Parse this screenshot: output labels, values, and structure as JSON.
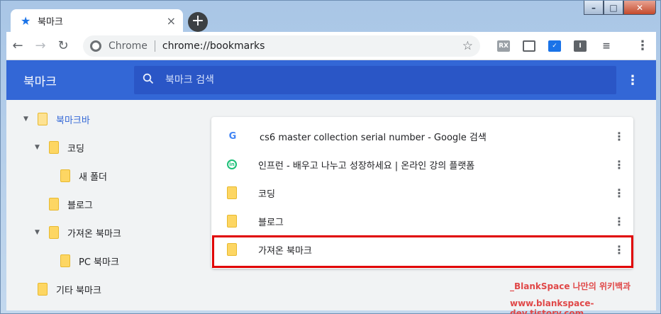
{
  "tab": {
    "title": "북마크",
    "close": "×"
  },
  "newtab": {
    "label": "+"
  },
  "window_controls": {
    "minimize": "–",
    "maximize": "□",
    "close": "✕"
  },
  "toolbar": {
    "back": "←",
    "forward": "→",
    "reload": "↻",
    "site_label": "Chrome",
    "url": "chrome://bookmarks",
    "star": "☆",
    "menu": "⋮"
  },
  "extensions": [
    {
      "name": "ext-rx",
      "label": "RX"
    },
    {
      "name": "ext-cast",
      "label": ""
    },
    {
      "name": "ext-check",
      "label": "✓"
    },
    {
      "name": "ext-i",
      "label": "I"
    },
    {
      "name": "ext-playlist",
      "label": "≡"
    }
  ],
  "app": {
    "title": "북마크",
    "search_placeholder": "북마크 검색",
    "menu": "⋮"
  },
  "tree": [
    {
      "label": "북마크바",
      "expanded": true,
      "selected": true,
      "depth": 0,
      "has_children": true
    },
    {
      "label": "코딩",
      "expanded": true,
      "selected": false,
      "depth": 1,
      "has_children": true
    },
    {
      "label": "새 폴더",
      "expanded": false,
      "selected": false,
      "depth": 2,
      "has_children": false
    },
    {
      "label": "블로그",
      "expanded": false,
      "selected": false,
      "depth": 1,
      "has_children": false
    },
    {
      "label": "가져온 북마크",
      "expanded": true,
      "selected": false,
      "depth": 1,
      "has_children": true
    },
    {
      "label": "PC 북마크",
      "expanded": false,
      "selected": false,
      "depth": 2,
      "has_children": false
    },
    {
      "label": "기타 북마크",
      "expanded": false,
      "selected": false,
      "depth": 0,
      "has_children": false
    }
  ],
  "list": [
    {
      "title": "cs6 master collection serial number - Google 검색",
      "icon": "google-icon",
      "glyph": "G"
    },
    {
      "title": "인프런 - 배우고 나누고 성장하세요 | 온라인 강의 플랫폼",
      "icon": "inflearn-icon",
      "glyph": "in"
    },
    {
      "title": "코딩",
      "icon": "folder-icon",
      "glyph": ""
    },
    {
      "title": "블로그",
      "icon": "folder-icon",
      "glyph": ""
    },
    {
      "title": "가져온 북마크",
      "icon": "folder-icon",
      "glyph": ""
    }
  ],
  "more_glyph": "⋮",
  "watermark": {
    "line1": "_BlankSpace 나만의 위키백과",
    "line2": "www.blankspace-dev.tistory.com"
  },
  "colors": {
    "accent": "#3367d6",
    "highlight": "#e00000",
    "folder": "#fdd663"
  }
}
